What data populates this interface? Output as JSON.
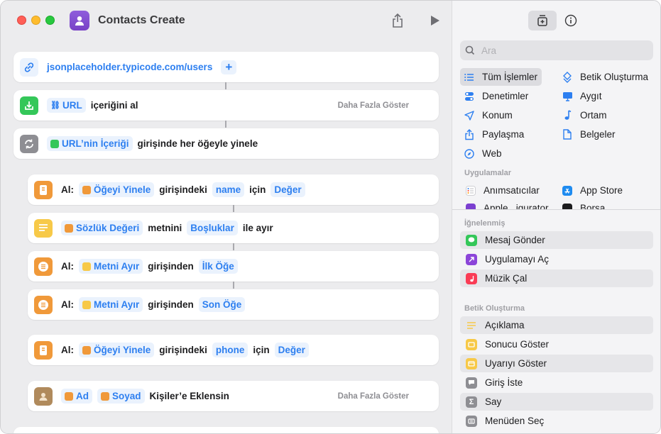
{
  "window": {
    "title": "Contacts Create"
  },
  "actions": [
    {
      "url": "jsonplaceholder.typicode.com/users"
    },
    {
      "token": "URL",
      "text": "içeriğini al",
      "more": "Daha Fazla Göster"
    },
    {
      "token": "URL’nin İçeriği",
      "text": "girişinde her öğeyle yinele"
    },
    {
      "prefix": "Al:",
      "token1": "Öğeyi Yinele",
      "text1": "girişindeki",
      "token2": "name",
      "text2": "için",
      "token3": "Değer"
    },
    {
      "token1": "Sözlük Değeri",
      "text1": "metnini",
      "token2": "Boşluklar",
      "text2": "ile ayır"
    },
    {
      "prefix": "Al:",
      "token1": "Metni Ayır",
      "text1": "girişinden",
      "token2": "İlk Öğe"
    },
    {
      "prefix": "Al:",
      "token1": "Metni Ayır",
      "text1": "girişinden",
      "token2": "Son Öğe"
    },
    {
      "prefix": "Al:",
      "token1": "Öğeyi Yinele",
      "text1": "girişindeki",
      "token2": "phone",
      "text2": "için",
      "token3": "Değer"
    },
    {
      "token1": "Ad",
      "token2": "Soyad",
      "text": "Kişiler’e Eklensin",
      "more": "Daha Fazla Göster"
    }
  ],
  "sidebar": {
    "search_placeholder": "Ara",
    "categories_left": [
      "Tüm İşlemler",
      "Denetimler",
      "Konum",
      "Paylaşma",
      "Web"
    ],
    "categories_right": [
      "Betik Oluşturma",
      "Aygıt",
      "Ortam",
      "Belgeler"
    ],
    "apps_label": "Uygulamalar",
    "apps": [
      "Anımsatıcılar",
      "App Store",
      "Apple...igurator",
      "Borsa"
    ],
    "pinned_label": "İğnelenmiş",
    "pinned": [
      "Mesaj Gönder",
      "Uygulamayı Aç",
      "Müzik Çal"
    ],
    "scripting_label": "Betik Oluşturma",
    "scripting": [
      "Açıklama",
      "Sonucu Göster",
      "Uyarıyı Göster",
      "Giriş İste",
      "Say",
      "Menüden Seç"
    ]
  },
  "colors": {
    "accent": "#2d7ff0",
    "token_bg": "#eaf2fd",
    "app_icon": "#7842c6",
    "orange_action": "#f0993a",
    "green_action": "#34c759",
    "yellow_action": "#f7c948"
  }
}
